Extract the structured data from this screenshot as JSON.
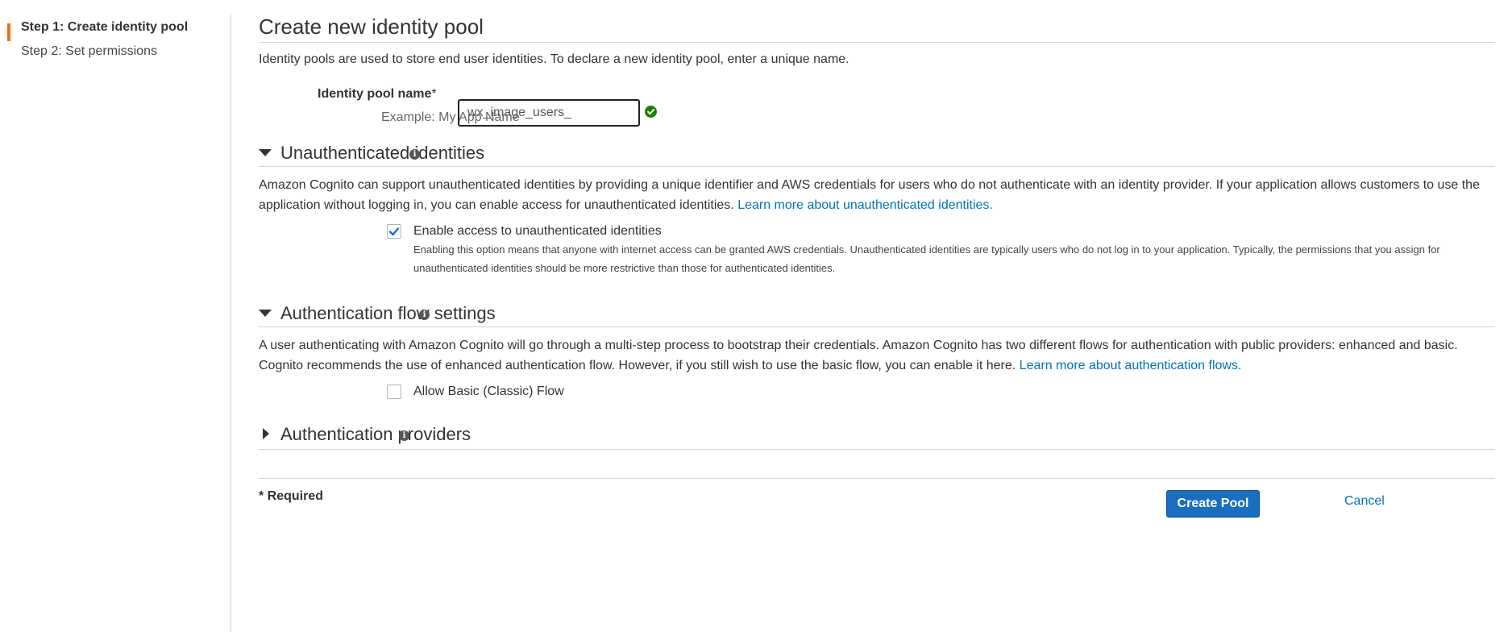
{
  "sidebar": {
    "steps": [
      {
        "label": "Step 1: Create identity pool",
        "active": true
      },
      {
        "label": "Step 2: Set permissions",
        "active": false
      }
    ]
  },
  "page": {
    "title": "Create new identity pool",
    "intro": "Identity pools are used to store end user identities. To declare a new identity pool, enter a unique name."
  },
  "pool_name": {
    "label": "Identity pool name",
    "required_mark": "*",
    "value": "wx_image_users_",
    "hint": "Example: My App Name",
    "valid": true
  },
  "sections": {
    "unauth": {
      "title": "Unauthenticated identities",
      "expanded": true,
      "text": "Amazon Cognito can support unauthenticated identities by providing a unique identifier and AWS credentials for users who do not authenticate with an identity provider. If your application allows customers to use the application without logging in, you can enable access for unauthenticated identities.",
      "link": "Learn more about unauthenticated identities.",
      "checkbox_label": "Enable access to unauthenticated identities",
      "checkbox_checked": true,
      "checkbox_desc": "Enabling this option means that anyone with internet access can be granted AWS credentials. Unauthenticated identities are typically users who do not log in to your application. Typically, the permissions that you assign for unauthenticated identities should be more restrictive than those for authenticated identities."
    },
    "authflow": {
      "title": "Authentication flow settings",
      "expanded": true,
      "text": "A user authenticating with Amazon Cognito will go through a multi-step process to bootstrap their credentials. Amazon Cognito has two different flows for authentication with public providers: enhanced and basic. Cognito recommends the use of enhanced authentication flow. However, if you still wish to use the basic flow, you can enable it here.",
      "link": "Learn more about authentication flows.",
      "checkbox_label": "Allow Basic (Classic) Flow",
      "checkbox_checked": false
    },
    "providers": {
      "title": "Authentication providers",
      "expanded": false
    }
  },
  "footer": {
    "required_note": "* Required",
    "cancel_label": "Cancel",
    "create_label": "Create Pool"
  },
  "colors": {
    "accent_orange": "#ec7211",
    "link_blue": "#0073bb",
    "primary_button": "#1a6ec1",
    "valid_green": "#1d8102"
  },
  "icons": {
    "valid": "check-circle-icon",
    "info": "info-icon",
    "expanded": "caret-down-icon",
    "collapsed": "caret-right-icon"
  }
}
